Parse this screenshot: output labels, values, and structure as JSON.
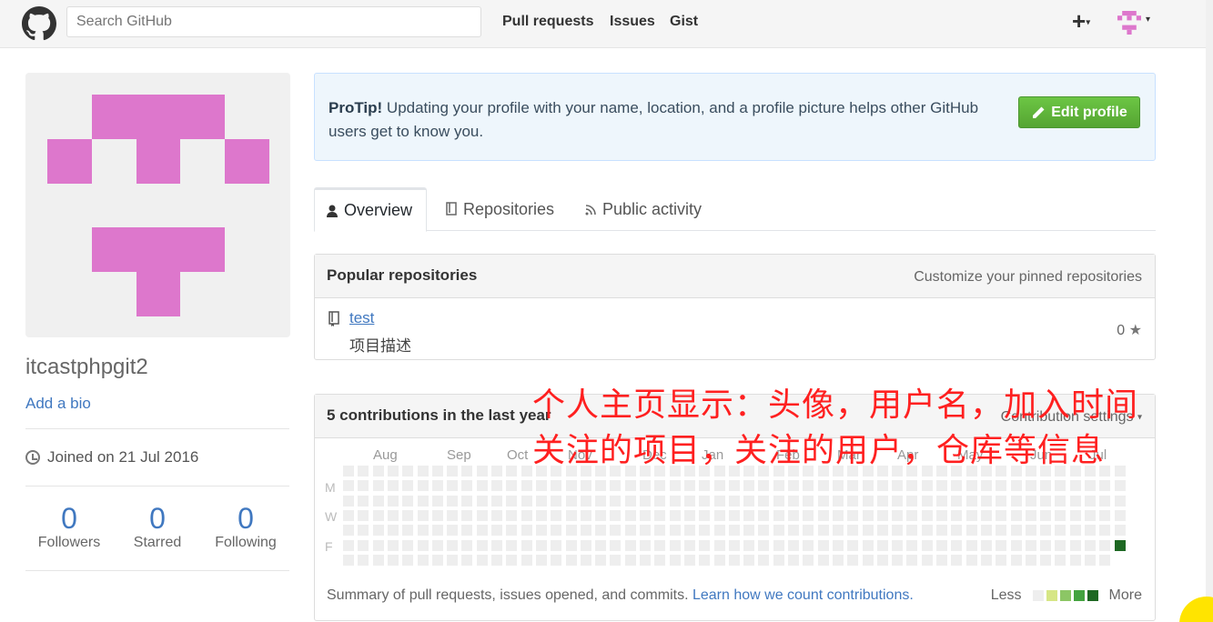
{
  "header": {
    "search_placeholder": "Search GitHub",
    "nav": [
      "Pull requests",
      "Issues",
      "Gist"
    ],
    "plus": "+",
    "caret": "▾"
  },
  "profile": {
    "username": "itcastphpgit2",
    "add_bio": "Add a bio",
    "joined": "Joined on 21 Jul 2016",
    "stats": [
      {
        "num": "0",
        "label": "Followers"
      },
      {
        "num": "0",
        "label": "Starred"
      },
      {
        "num": "0",
        "label": "Following"
      }
    ],
    "identicon_color": "#dd77cc"
  },
  "protip": {
    "bold": "ProTip!",
    "text": " Updating your profile with your name, location, and a profile picture helps other GitHub users get to know you.",
    "edit_button": "Edit profile"
  },
  "tabs": {
    "overview": "Overview",
    "repositories": "Repositories",
    "public_activity": "Public activity"
  },
  "popular": {
    "title": "Popular repositories",
    "customize": "Customize your pinned repositories",
    "repo_name": "test",
    "repo_desc": "项目描述",
    "repo_stars": "0"
  },
  "contributions": {
    "title": "5 contributions in the last year",
    "settings": "Contribution settings",
    "months": [
      "Aug",
      "Sep",
      "Oct",
      "Nov",
      "Dec",
      "Jan",
      "Feb",
      "Mar",
      "Apr",
      "May",
      "Jun",
      "Jul"
    ],
    "days": [
      "M",
      "W",
      "F"
    ],
    "summary": "Summary of pull requests, issues opened, and commits.",
    "learn_link": "Learn how we count contributions.",
    "less": "Less",
    "more": "More",
    "legend_colors": [
      "#eeeeee",
      "#d6e685",
      "#8cc665",
      "#44a340",
      "#1e6823"
    ],
    "active_color": "#1e6823"
  },
  "annotation": {
    "line1": "个人主页显示：头像，用户名，加入时间",
    "line2": "关注的项目，关注的用户，仓库等信息",
    "color": "#ff2020"
  }
}
